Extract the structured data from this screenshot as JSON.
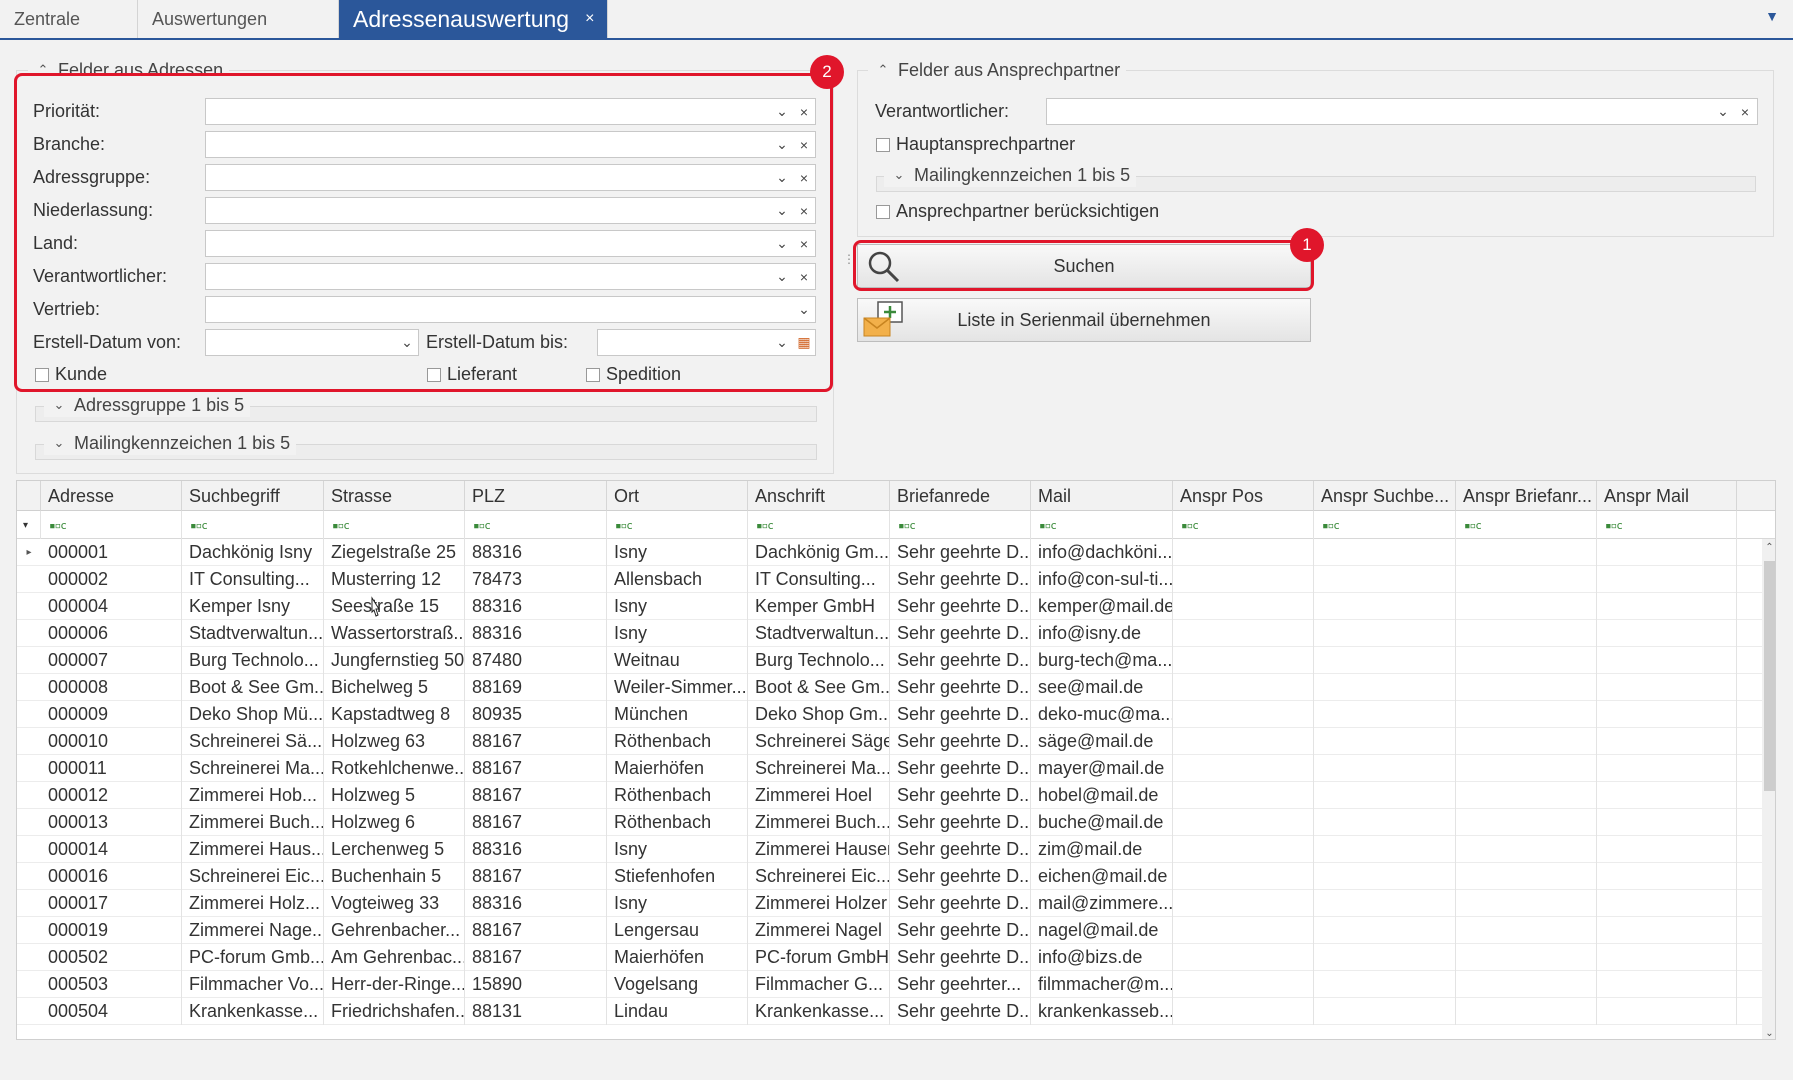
{
  "tabs": [
    {
      "label": "Zentrale"
    },
    {
      "label": "Auswertungen"
    },
    {
      "label": "Adressenauswertung",
      "close": "×"
    }
  ],
  "tab_menu_icon": "chevron-down-icon",
  "adressen": {
    "title": "Felder aus Adressen",
    "fields": {
      "prioritaet": "Priorität:",
      "branche": "Branche:",
      "adressgruppe": "Adressgruppe:",
      "niederlassung": "Niederlassung:",
      "land": "Land:",
      "verantwortlicher": "Verantwortlicher:",
      "vertrieb": "Vertrieb:",
      "erstell_von": "Erstell-Datum von:",
      "erstell_bis": "Erstell-Datum bis:"
    },
    "checkboxes": {
      "kunde": "Kunde",
      "lieferant": "Lieferant",
      "spedition": "Spedition"
    },
    "sub_adressgruppe": "Adressgruppe 1 bis 5",
    "sub_mailing": "Mailingkennzeichen 1 bis 5"
  },
  "ansprech": {
    "title": "Felder aus Ansprechpartner",
    "verantwortlicher": "Verantwortlicher:",
    "hauptansprech": "Hauptansprechpartner",
    "mailing": "Mailingkennzeichen 1 bis 5",
    "beruecksichtigen": "Ansprechpartner berücksichtigen"
  },
  "buttons": {
    "suchen": "Suchen",
    "serienmail": "Liste in Serienmail übernehmen"
  },
  "badges": {
    "one": "1",
    "two": "2"
  },
  "colors": {
    "accent": "#2b579a",
    "highlight": "#e0162b"
  },
  "grid": {
    "columns": [
      "Adresse",
      "Suchbegriff",
      "Strasse",
      "PLZ",
      "Ort",
      "Anschrift",
      "Briefanrede",
      "Mail",
      "Anspr Pos",
      "Anspr Suchbe...",
      "Anspr Briefanr...",
      "Anspr Mail"
    ],
    "filter_icon": "filter-icon",
    "rows": [
      [
        "000001",
        "Dachkönig Isny",
        "Ziegelstraße 25",
        "88316",
        "Isny",
        "Dachkönig Gm...",
        "Sehr geehrte D...",
        "info@dachköni...",
        "",
        "",
        "",
        ""
      ],
      [
        "000002",
        "IT Consulting...",
        "Musterring 12",
        "78473",
        "Allensbach",
        "IT Consulting...",
        "Sehr geehrte D...",
        "info@con-sul-ti...",
        "",
        "",
        "",
        ""
      ],
      [
        "000004",
        "Kemper Isny",
        "Seestraße 15",
        "88316",
        "Isny",
        "Kemper GmbH",
        "Sehr geehrte D...",
        "kemper@mail.de",
        "",
        "",
        "",
        ""
      ],
      [
        "000006",
        "Stadtverwaltun...",
        "Wassertorstraß...",
        "88316",
        "Isny",
        "Stadtverwaltun...",
        "Sehr geehrte D...",
        "info@isny.de",
        "",
        "",
        "",
        ""
      ],
      [
        "000007",
        "Burg Technolo...",
        "Jungfernstieg 50",
        "87480",
        "Weitnau",
        "Burg Technolo...",
        "Sehr geehrte D...",
        "burg-tech@ma...",
        "",
        "",
        "",
        ""
      ],
      [
        "000008",
        "Boot & See Gm...",
        "Bichelweg 5",
        "88169",
        "Weiler-Simmer...",
        "Boot & See Gm...",
        "Sehr geehrte D...",
        "see@mail.de",
        "",
        "",
        "",
        ""
      ],
      [
        "000009",
        "Deko Shop Mü...",
        "Kapstadtweg 8",
        "80935",
        "München",
        "Deko Shop Gm...",
        "Sehr geehrte D...",
        "deko-muc@ma...",
        "",
        "",
        "",
        ""
      ],
      [
        "000010",
        "Schreinerei Sä...",
        "Holzweg 63",
        "88167",
        "Röthenbach",
        "Schreinerei Säge",
        "Sehr geehrte D...",
        "säge@mail.de",
        "",
        "",
        "",
        ""
      ],
      [
        "000011",
        "Schreinerei Ma...",
        "Rotkehlchenwe...",
        "88167",
        "Maierhöfen",
        "Schreinerei Ma...",
        "Sehr geehrte D...",
        "mayer@mail.de",
        "",
        "",
        "",
        ""
      ],
      [
        "000012",
        "Zimmerei Hob...",
        "Holzweg 5",
        "88167",
        "Röthenbach",
        "Zimmerei Hoel",
        "Sehr geehrte D...",
        "hobel@mail.de",
        "",
        "",
        "",
        ""
      ],
      [
        "000013",
        "Zimmerei Buch...",
        "Holzweg 6",
        "88167",
        "Röthenbach",
        "Zimmerei Buch...",
        "Sehr geehrte D...",
        "buche@mail.de",
        "",
        "",
        "",
        ""
      ],
      [
        "000014",
        "Zimmerei Haus...",
        "Lerchenweg 5",
        "88316",
        "Isny",
        "Zimmerei Hauser",
        "Sehr geehrte D...",
        "zim@mail.de",
        "",
        "",
        "",
        ""
      ],
      [
        "000016",
        "Schreinerei Eic...",
        "Buchenhain 5",
        "88167",
        "Stiefenhofen",
        "Schreinerei Eic...",
        "Sehr geehrte D...",
        "eichen@mail.de",
        "",
        "",
        "",
        ""
      ],
      [
        "000017",
        "Zimmerei Holz...",
        "Vogteiweg 33",
        "88316",
        "Isny",
        "Zimmerei Holzer",
        "Sehr geehrte D...",
        "mail@zimmere...",
        "",
        "",
        "",
        ""
      ],
      [
        "000019",
        "Zimmerei Nage...",
        "Gehrenbacher...",
        "88167",
        "Lengersau",
        "Zimmerei Nagel",
        "Sehr geehrte D...",
        "nagel@mail.de",
        "",
        "",
        "",
        ""
      ],
      [
        "000502",
        "PC-forum Gmb...",
        "Am Gehrenbac...",
        "88167",
        "Maierhöfen",
        "PC-forum GmbH",
        "Sehr geehrte D...",
        "info@bizs.de",
        "",
        "",
        "",
        ""
      ],
      [
        "000503",
        "Filmmacher Vo...",
        "Herr-der-Ringe...",
        "15890",
        "Vogelsang",
        "Filmmacher G...",
        "Sehr geehrter...",
        "filmmacher@m...",
        "",
        "",
        "",
        ""
      ],
      [
        "000504",
        "Krankenkasse...",
        "Friedrichshafen...",
        "88131",
        "Lindau",
        "Krankenkasse...",
        "Sehr geehrte D...",
        "krankenkasseb...",
        "",
        "",
        "",
        ""
      ]
    ]
  }
}
